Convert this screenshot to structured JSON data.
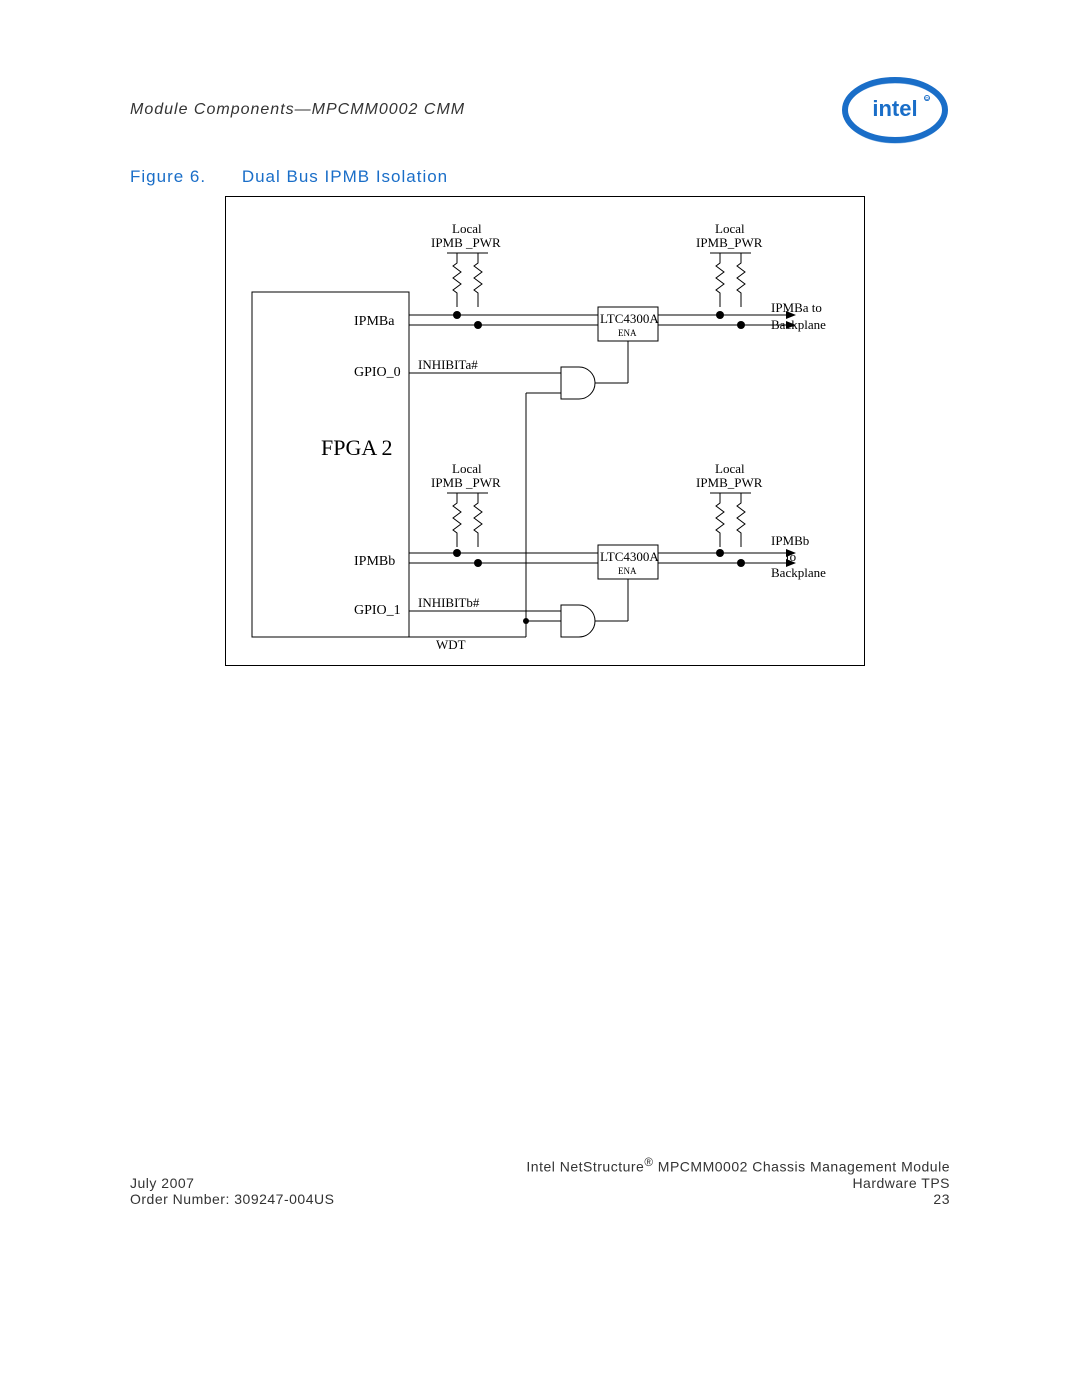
{
  "header": {
    "breadcrumb": "Module Components—MPCMM0002 CMM"
  },
  "figure": {
    "number": "Figure 6.",
    "title": "Dual Bus IPMB Isolation"
  },
  "diagram": {
    "fpga": "FPGA 2",
    "left_labels": {
      "ipmba": "IPMBa",
      "gpio0": "GPIO_0",
      "ipmbb": "IPMBb",
      "gpio1": "GPIO_1"
    },
    "signals": {
      "inhibita": "INHIBITa#",
      "inhibitb": "INHIBITb#",
      "wdt": "WDT"
    },
    "local_pwr_left_a": {
      "l1": "Local",
      "l2": "IPMB _PWR"
    },
    "local_pwr_right_a": {
      "l1": "Local",
      "l2": "IPMB_PWR"
    },
    "local_pwr_left_b": {
      "l1": "Local",
      "l2": "IPMB _PWR"
    },
    "local_pwr_right_b": {
      "l1": "Local",
      "l2": "IPMB_PWR"
    },
    "chip_a": "LTC4300A",
    "chip_b": "LTC4300A",
    "ena": "ENA",
    "right_a": {
      "l1": "IPMBa to",
      "l2": "Backplane"
    },
    "right_b": {
      "l1": "IPMBb",
      "l2": "to",
      "l3": "Backplane"
    }
  },
  "footer": {
    "date": "July 2007",
    "order": "Order Number: 309247-004US",
    "prod1": "Intel NetStructure",
    "prod2": " MPCMM0002 Chassis Management Module",
    "doc": "Hardware TPS",
    "page": "23"
  }
}
